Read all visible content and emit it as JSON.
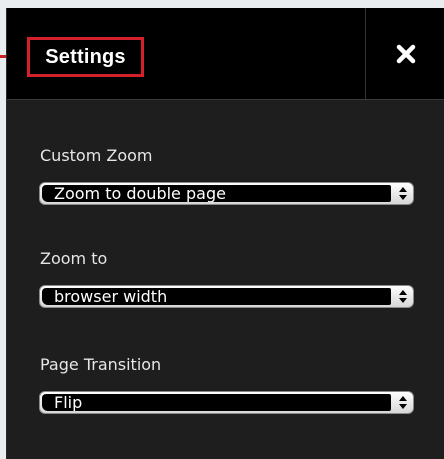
{
  "header": {
    "title": "Settings",
    "close_icon": "close-icon"
  },
  "colors": {
    "panel_bg": "#1e1e1e",
    "header_bg": "#000000",
    "highlight": "#d4202a"
  },
  "settings": [
    {
      "label": "Custom Zoom",
      "value": "Zoom to double page"
    },
    {
      "label": "Zoom to",
      "value": "browser width"
    },
    {
      "label": "Page Transition",
      "value": "Flip"
    }
  ]
}
